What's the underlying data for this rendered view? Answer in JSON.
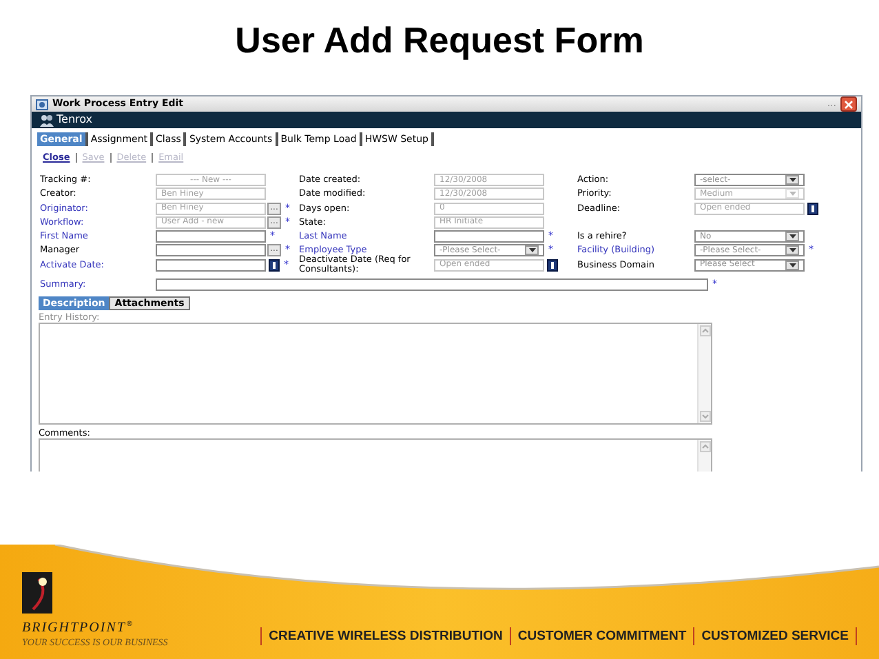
{
  "slide_title": "User Add Request Form",
  "window": {
    "title": "Work Process Entry Edit",
    "title_extra": "...",
    "brand": "Tenrox"
  },
  "tabs": [
    {
      "label": "General",
      "selected": true
    },
    {
      "label": "Assignment",
      "selected": false
    },
    {
      "label": "Class",
      "selected": false
    },
    {
      "label": "System Accounts",
      "selected": false
    },
    {
      "label": "Bulk Temp Load",
      "selected": false
    },
    {
      "label": "HWSW Setup",
      "selected": false
    }
  ],
  "actions": [
    {
      "label": "Close",
      "disabled": false
    },
    {
      "label": "Save",
      "disabled": true
    },
    {
      "label": "Delete",
      "disabled": true
    },
    {
      "label": "Email",
      "disabled": true
    }
  ],
  "form_rows": [
    [
      {
        "label": "Tracking #:",
        "link": false,
        "kind": "text",
        "value": "--- New ---",
        "centered": true,
        "disabled": true
      },
      {
        "label": "Date created:",
        "link": false,
        "kind": "text",
        "value": "12/30/2008",
        "disabled": true
      },
      {
        "label": "Action:",
        "link": false,
        "kind": "select",
        "value": "-select-",
        "disabled": false
      }
    ],
    [
      {
        "label": "Creator:",
        "link": false,
        "kind": "text",
        "value": "Ben Hiney",
        "disabled": true
      },
      {
        "label": "Date modified:",
        "link": false,
        "kind": "text",
        "value": "12/30/2008",
        "disabled": true
      },
      {
        "label": "Priority:",
        "link": false,
        "kind": "select",
        "value": "Medium",
        "disabled": true
      }
    ],
    [
      {
        "label": "Originator:",
        "link": true,
        "kind": "lookup",
        "value": "Ben Hiney",
        "button_label": "...",
        "disabled": true,
        "required_mark": "*"
      },
      {
        "label": "Days open:",
        "link": false,
        "kind": "text",
        "value": "0",
        "disabled": true
      },
      {
        "label": "Deadline:",
        "link": false,
        "kind": "date",
        "value": "Open ended",
        "disabled": true
      }
    ],
    [
      {
        "label": "Workflow:",
        "link": true,
        "kind": "lookup",
        "value": "User Add - new",
        "button_label": "...",
        "disabled": true,
        "required_mark": "*"
      },
      {
        "label": "State:",
        "link": false,
        "kind": "text",
        "value": "HR Initiate",
        "disabled": true
      }
    ],
    [
      {
        "label": "First Name",
        "link": true,
        "kind": "text",
        "disabled": false,
        "required_mark": "*"
      },
      {
        "label": "Last Name",
        "link": true,
        "kind": "text",
        "disabled": false,
        "required_mark": "*"
      },
      {
        "label": "Is a rehire?",
        "link": false,
        "kind": "select",
        "value": "No",
        "disabled": false
      }
    ],
    [
      {
        "label": "Manager",
        "link": false,
        "kind": "lookup",
        "button_label": "...",
        "disabled": false,
        "required_mark": "*"
      },
      {
        "label": "Employee Type",
        "link": true,
        "kind": "select",
        "value": "-Please Select-",
        "disabled": false,
        "required_mark": "*"
      },
      {
        "label": "Facility (Building)",
        "link": true,
        "kind": "select",
        "value": "-Please Select-",
        "disabled": false,
        "required_mark": "*"
      }
    ],
    [
      {
        "label": "Activate Date:",
        "link": true,
        "kind": "date",
        "disabled": false,
        "required_mark": "*"
      },
      {
        "label": "Deactivate Date (Req for Consultants):",
        "link": false,
        "kind": "date",
        "value": "Open ended",
        "disabled": true
      },
      {
        "label": "Business Domain",
        "link": false,
        "kind": "select",
        "value": "Please Select",
        "disabled": false
      }
    ]
  ],
  "summary": {
    "label": "Summary:",
    "link": true,
    "required_mark": "*"
  },
  "detail_tabs": [
    {
      "label": "Description",
      "selected": true
    },
    {
      "label": "Attachments",
      "selected": false
    }
  ],
  "entry_history": {
    "label": "Entry History:",
    "disabled": true
  },
  "comments": {
    "label": "Comments:",
    "disabled": false
  },
  "footer": {
    "company": "BRIGHTPOINT",
    "registered": "®",
    "motto": "YOUR SUCCESS IS OUR BUSINESS",
    "taglines": [
      "CREATIVE WIRELESS DISTRIBUTION",
      "CUSTOMER COMMITMENT",
      "CUSTOMIZED SERVICE"
    ]
  }
}
